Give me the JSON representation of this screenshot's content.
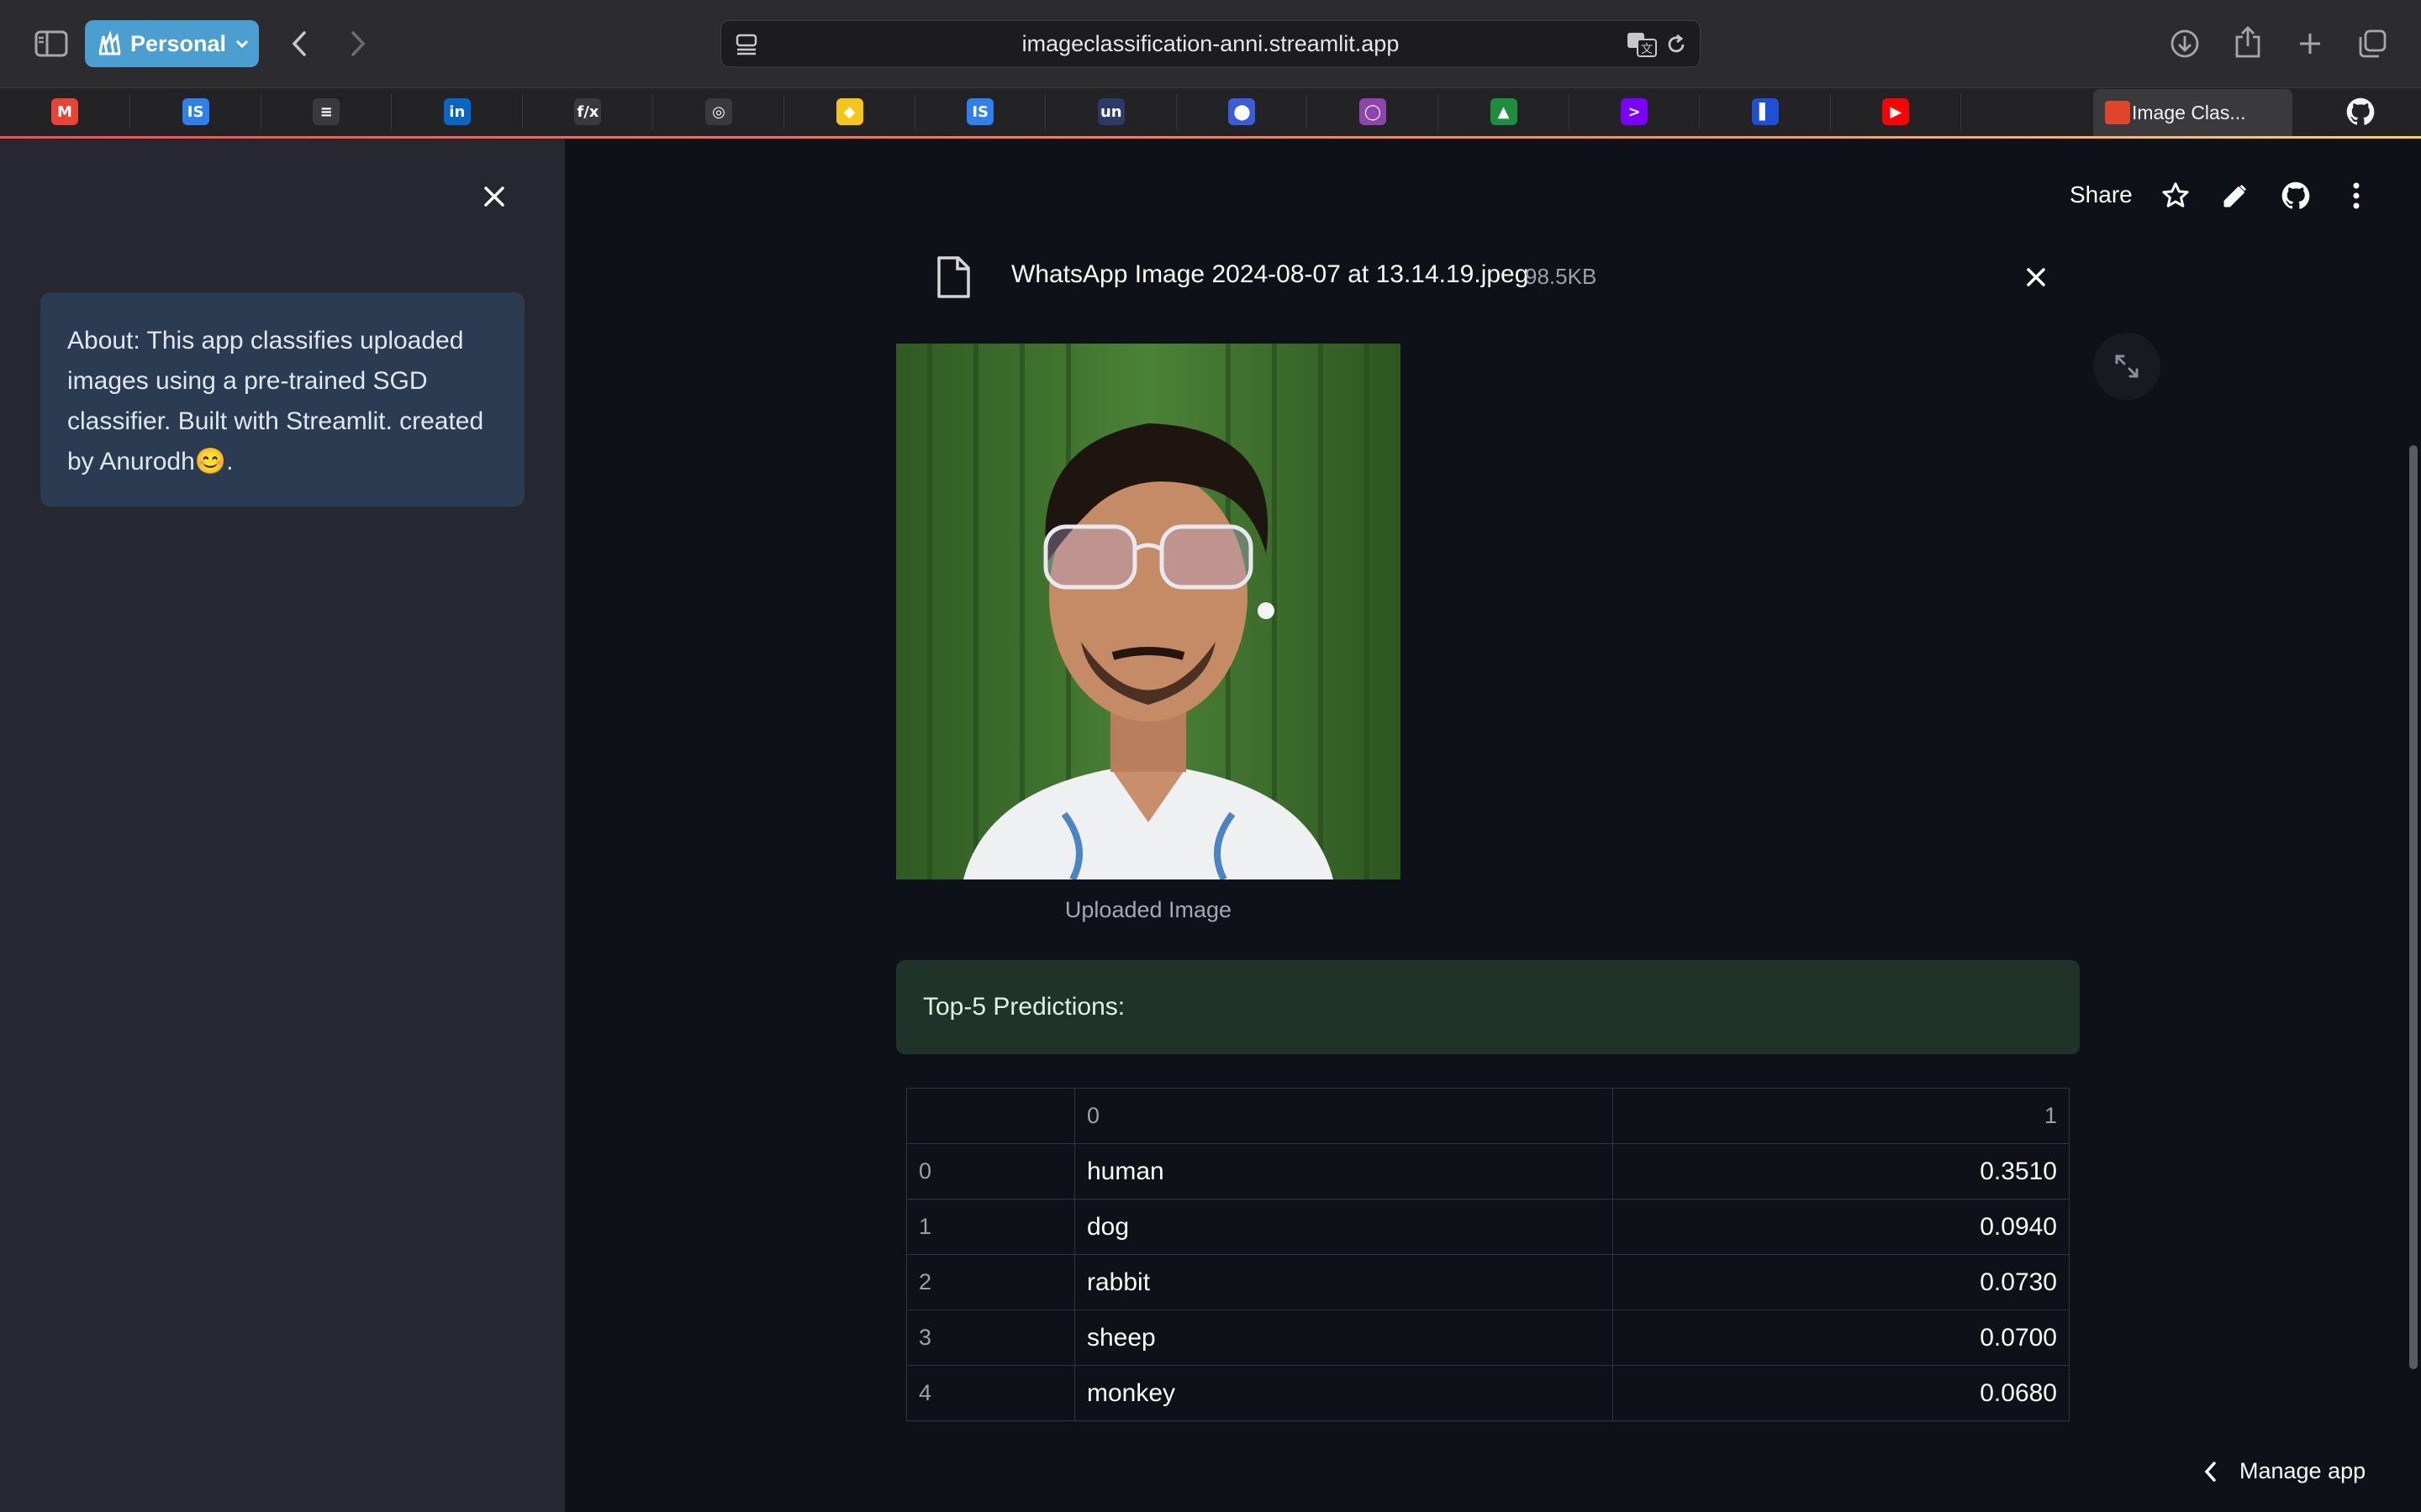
{
  "browser": {
    "profile_name": "Personal",
    "url": "imageclassification-anni.streamlit.app",
    "bookmarks": [
      {
        "name": "gmail-favicon",
        "glyph": "M",
        "color": "#ea4335"
      },
      {
        "name": "is-favicon",
        "glyph": "IS",
        "color": "#2f80ed"
      },
      {
        "name": "news-favicon",
        "glyph": "≡",
        "color": "#3a3a3c"
      },
      {
        "name": "linkedin-favicon",
        "glyph": "in",
        "color": "#0a66c2"
      },
      {
        "name": "formula-favicon",
        "glyph": "f/x",
        "color": "#3a3a3c"
      },
      {
        "name": "openai-favicon",
        "glyph": "◎",
        "color": "#3a3a3c"
      },
      {
        "name": "yellow-favicon",
        "glyph": "◆",
        "color": "#f5c518"
      },
      {
        "name": "is-favicon-2",
        "glyph": "IS",
        "color": "#2f80ed"
      },
      {
        "name": "un-favicon",
        "glyph": "un",
        "color": "#2b3a67"
      },
      {
        "name": "blue-circle-favicon",
        "glyph": "⬤",
        "color": "#3b5bdb"
      },
      {
        "name": "proton-favicon",
        "glyph": "◯",
        "color": "#8e44ad"
      },
      {
        "name": "drive-favicon",
        "glyph": "▲",
        "color": "#1e8e3e"
      },
      {
        "name": "accenture-favicon",
        "glyph": ">",
        "color": "#7b00ff"
      },
      {
        "name": "book-favicon",
        "glyph": "▌",
        "color": "#1e4fd6"
      },
      {
        "name": "youtube-favicon",
        "glyph": "▶",
        "color": "#ff0000"
      },
      {
        "name": "github-favicon",
        "glyph": "●",
        "color": "#f5f5f5"
      }
    ],
    "active_tab_title": "Image Clas..."
  },
  "sidebar": {
    "about_text": "About: This app classifies uploaded images using a pre-trained SGD classifier. Built with Streamlit. created by Anurodh😊."
  },
  "header": {
    "share_label": "Share"
  },
  "upload": {
    "file_name": "WhatsApp Image 2024-08-07 at 13.14.19.jpeg",
    "file_size": "98.5KB"
  },
  "image": {
    "caption": "Uploaded Image"
  },
  "result": {
    "message": "Top-5 Predictions:"
  },
  "predictions": {
    "columns": [
      "",
      "0",
      "1"
    ],
    "rows": [
      {
        "index": "0",
        "label": "human",
        "prob": "0.3510"
      },
      {
        "index": "1",
        "label": "dog",
        "prob": "0.0940"
      },
      {
        "index": "2",
        "label": "rabbit",
        "prob": "0.0730"
      },
      {
        "index": "3",
        "label": "sheep",
        "prob": "0.0700"
      },
      {
        "index": "4",
        "label": "monkey",
        "prob": "0.0680"
      }
    ]
  },
  "footer": {
    "manage_app_label": "Manage app"
  },
  "colors": {
    "streamlit_accent": "#ff4b4b",
    "info_box": "#2b3b52",
    "success_box": "#1f3328"
  }
}
